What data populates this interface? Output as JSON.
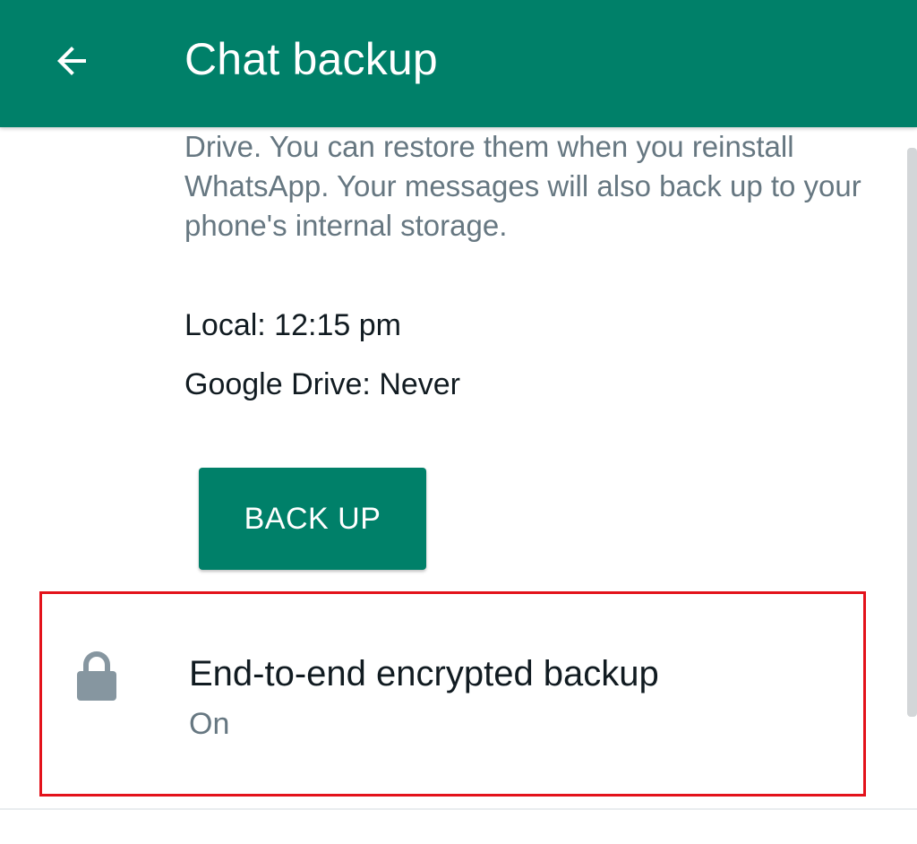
{
  "app_bar": {
    "title": "Chat backup",
    "back_icon": "arrow-left-icon",
    "background": "#008069"
  },
  "description": "Drive. You can restore them when you reinstall WhatsApp. Your messages will also back up to your phone's internal storage.",
  "last_backup": {
    "local": "Local: 12:15 pm",
    "google_drive": "Google Drive: Never"
  },
  "backup_button": {
    "label": "BACK UP",
    "color": "#008069"
  },
  "e2e_backup": {
    "icon": "lock-icon",
    "title": "End-to-end encrypted backup",
    "status": "On"
  },
  "highlight_color": "#e3121b"
}
